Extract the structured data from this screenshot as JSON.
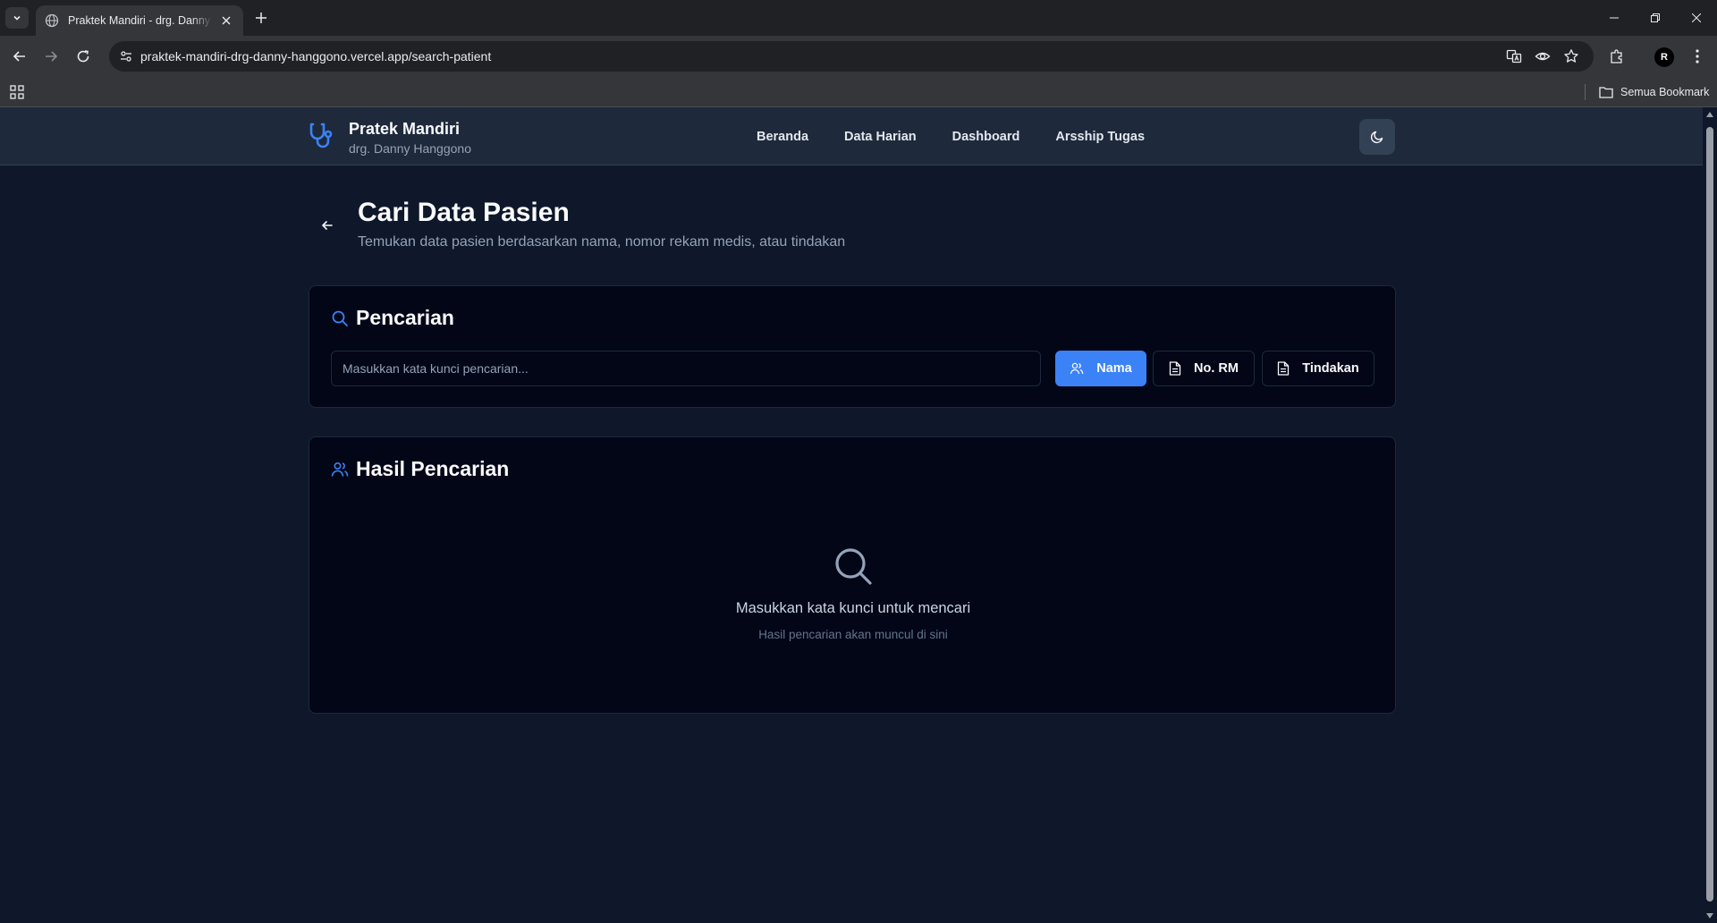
{
  "browser": {
    "tab_title": "Praktek Mandiri - drg. Danny Hanggono",
    "url_host": "praktek-mandiri-drg-danny-hanggono.vercel.app",
    "url_path": "/search-patient",
    "bookmarks_all_label": "Semua Bookmark",
    "profile_initial": "R"
  },
  "header": {
    "brand_name": "Pratek Mandiri",
    "brand_sub": "drg. Danny Hanggono",
    "nav": [
      "Beranda",
      "Data Harian",
      "Dashboard",
      "Arsship Tugas"
    ]
  },
  "page": {
    "title": "Cari Data Pasien",
    "subtitle": "Temukan data pasien berdasarkan nama, nomor rekam medis, atau tindakan"
  },
  "search": {
    "title": "Pencarian",
    "placeholder": "Masukkan kata kunci pencarian...",
    "value": "",
    "filters": [
      {
        "label": "Nama",
        "active": true,
        "icon": "users-icon"
      },
      {
        "label": "No. RM",
        "active": false,
        "icon": "file-text-icon"
      },
      {
        "label": "Tindakan",
        "active": false,
        "icon": "file-text-icon"
      }
    ]
  },
  "results": {
    "title": "Hasil Pencarian",
    "empty_message": "Masukkan kata kunci untuk mencari",
    "empty_hint": "Hasil pencarian akan muncul di sini"
  },
  "colors": {
    "accent": "#3b82f6",
    "page_bg": "#0f172a",
    "card_bg": "#020617",
    "header_bg": "#1e293b"
  }
}
